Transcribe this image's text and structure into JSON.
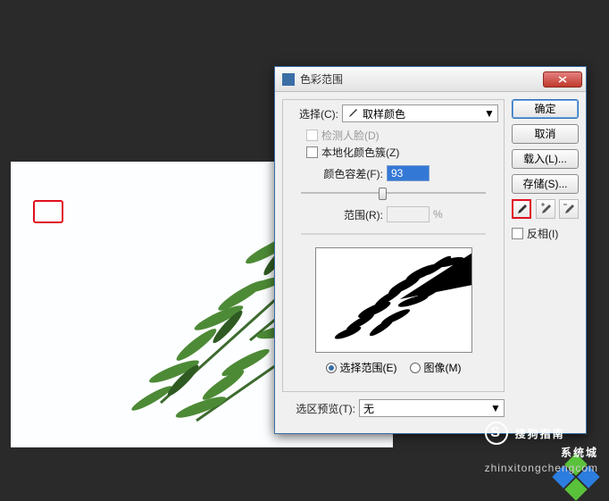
{
  "dialog": {
    "title": "色彩范围",
    "select_label": "选择(C):",
    "select_value": "取样颜色",
    "detect_faces": "检测人脸(D)",
    "localized": "本地化颜色簇(Z)",
    "fuzziness_label": "颜色容差(F):",
    "fuzziness_value": "93",
    "range_label": "范围(R):",
    "range_value": "",
    "percent": "%",
    "radio_selection": "选择范围(E)",
    "radio_image": "图像(M)",
    "preview_label": "选区预览(T):",
    "preview_value": "无"
  },
  "buttons": {
    "ok": "确定",
    "cancel": "取消",
    "load": "载入(L)...",
    "save": "存储(S)..."
  },
  "invert": "反相(I)",
  "watermark": {
    "brand1": "搜狗指南",
    "brand2": "系统城",
    "url": "zhinxitongchengcom"
  }
}
